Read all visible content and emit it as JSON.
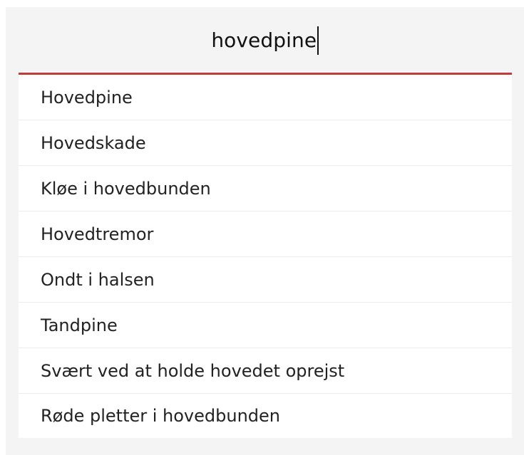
{
  "search": {
    "value": "hovedpine"
  },
  "results": [
    "Hovedpine",
    "Hovedskade",
    "Kløe i hovedbunden",
    "Hovedtremor",
    "Ondt i halsen",
    "Tandpine",
    "Svært ved at holde hovedet oprejst",
    "Røde pletter i hovedbunden"
  ],
  "colors": {
    "accent": "#c33a3a",
    "panel_background": "#f4f4f4",
    "list_background": "#ffffff"
  }
}
